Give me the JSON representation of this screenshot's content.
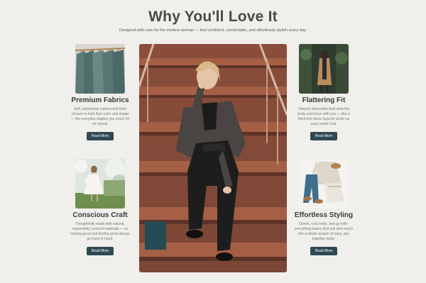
{
  "section": {
    "title": "Why You'll Love It",
    "subtitle": "Designed with care for the modern woman — feel confident, comfortable, and effortlessly stylish every day."
  },
  "cards": [
    {
      "title": "Premium Fabrics",
      "text": "Soft, substantial cottons and knits chosen to hold their color and shape — the everyday staples you reach for on repeat.",
      "button": "Read More",
      "icon": "clothing-rack-photo"
    },
    {
      "title": "Flattering Fit",
      "text": "Tailored silhouettes that skim the body and move with you — like a fitted knit dress layered under an easy camel coat.",
      "button": "Read More",
      "icon": "camel-coat-photo"
    },
    {
      "title": "Conscious Craft",
      "text": "Thoughtfully made with natural, responsibly sourced materials — so looking good and feeling good always go hand in hand.",
      "button": "Read More",
      "icon": "white-dress-photo"
    },
    {
      "title": "Effortless Styling",
      "text": "Denim, cozy knits, and go-with-everything basics that mix and match into a whole season of easy, put-together looks.",
      "button": "Read More",
      "icon": "flatlay-outfit-photo"
    }
  ],
  "colors": {
    "background": "#f1efec",
    "button": "#2e4a52",
    "title": "#4a4a4a"
  }
}
